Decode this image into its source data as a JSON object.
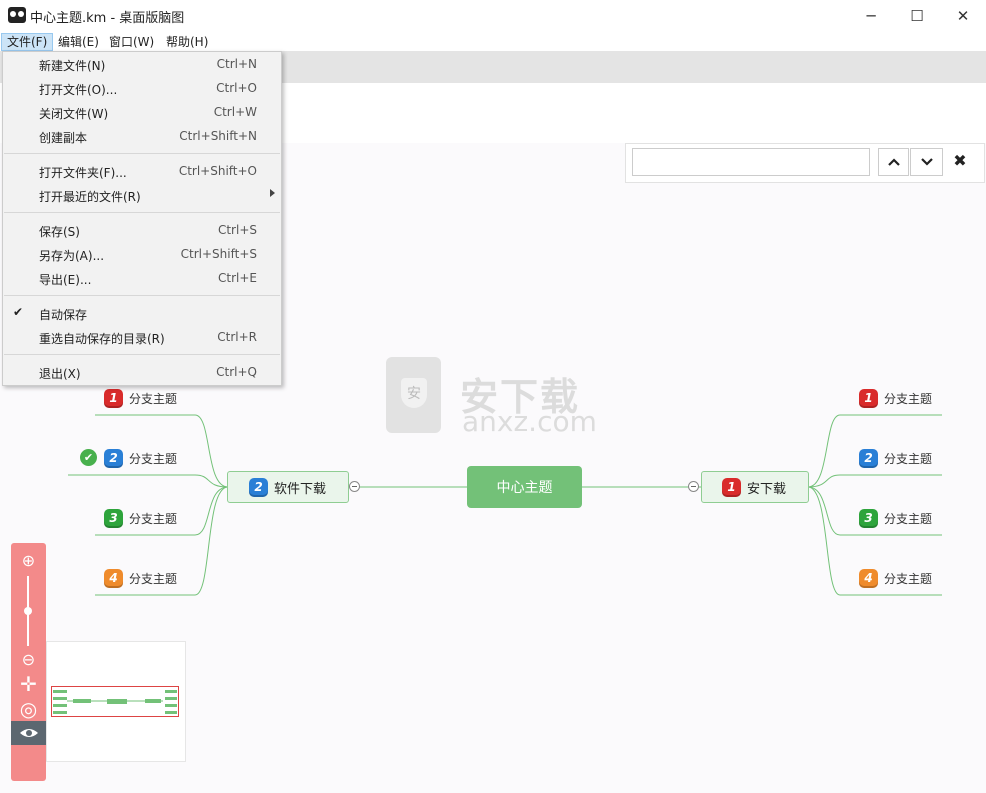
{
  "window": {
    "title": "中心主题.km - 桌面版脑图",
    "minimize": "─",
    "maximize": "☐",
    "close": "✕"
  },
  "menubar": [
    {
      "label": "文件(F)"
    },
    {
      "label": "编辑(E)"
    },
    {
      "label": "窗口(W)"
    },
    {
      "label": "帮助(H)"
    }
  ],
  "file_menu": {
    "groups": [
      [
        {
          "label": "新建文件(N)",
          "shortcut": "Ctrl+N"
        },
        {
          "label": "打开文件(O)...",
          "shortcut": "Ctrl+O"
        },
        {
          "label": "关闭文件(W)",
          "shortcut": "Ctrl+W"
        },
        {
          "label": "创建副本",
          "shortcut": "Ctrl+Shift+N"
        }
      ],
      [
        {
          "label": "打开文件夹(F)...",
          "shortcut": "Ctrl+Shift+O"
        },
        {
          "label": "打开最近的文件(R)",
          "shortcut": ""
        }
      ],
      [
        {
          "label": "保存(S)",
          "shortcut": "Ctrl+S"
        },
        {
          "label": "另存为(A)...",
          "shortcut": "Ctrl+Shift+S"
        },
        {
          "label": "导出(E)...",
          "shortcut": "Ctrl+E"
        }
      ],
      [
        {
          "label": "自动保存",
          "shortcut": "",
          "checked": true
        },
        {
          "label": "重选自动保存的目录(R)",
          "shortcut": "Ctrl+R"
        }
      ],
      [
        {
          "label": "退出(X)",
          "shortcut": "Ctrl+Q"
        }
      ]
    ]
  },
  "search": {
    "value": "",
    "up_icon": "chevron-up-icon",
    "down_icon": "chevron-down-icon",
    "close": "✖"
  },
  "mindmap": {
    "center": "中心主题",
    "left_main": {
      "label": "软件下载",
      "priority": "2"
    },
    "right_main": {
      "label": "安下载",
      "priority": "1"
    },
    "left_branches": [
      {
        "label": "分支主题",
        "priority": "1"
      },
      {
        "label": "分支主题",
        "priority": "2",
        "progress": "done"
      },
      {
        "label": "分支主题",
        "priority": "3"
      },
      {
        "label": "分支主题",
        "priority": "4"
      }
    ],
    "right_branches": [
      {
        "label": "分支主题",
        "priority": "1"
      },
      {
        "label": "分支主题",
        "priority": "2"
      },
      {
        "label": "分支主题",
        "priority": "3"
      },
      {
        "label": "分支主题",
        "priority": "4"
      }
    ],
    "line_color": "#73c178"
  },
  "zoom_panel": {
    "zoom_in": "⊕",
    "zoom_out": "⊖",
    "move": "✛",
    "locate": "◎",
    "zoom_level_fraction": 0.5
  },
  "watermark": {
    "title": "安下载",
    "subtitle": "anxz.com",
    "badge": "安"
  }
}
